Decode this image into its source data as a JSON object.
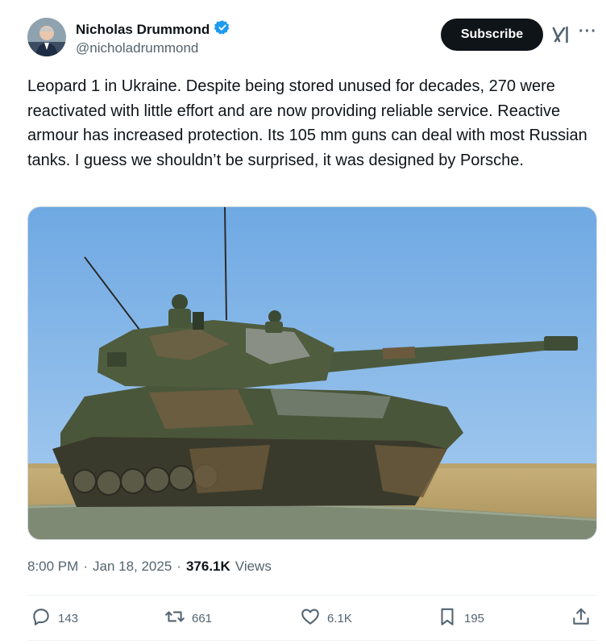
{
  "author": {
    "display_name": "Nicholas Drummond",
    "handle": "@nicholadrummond",
    "verified_icon": "verified-badge-icon"
  },
  "header": {
    "subscribe_label": "Subscribe",
    "grok_icon": "grok-icon",
    "more_icon": "more-icon"
  },
  "tweet": {
    "text": "Leopard 1 in Ukraine. Despite being stored unused for decades, 270 were reactivated with little effort and are now providing reliable service. Reactive armour has increased protection. Its 105 mm guns can deal with most Russian tanks. I guess we shouldn’t be surprised, it was designed by Porsche."
  },
  "meta": {
    "time": "8:00 PM",
    "date": "Jan 18, 2025",
    "separator": "·",
    "views_count": "376.1K",
    "views_label": "Views"
  },
  "actions": {
    "replies": "143",
    "reposts": "661",
    "likes": "6.1K",
    "bookmarks": "195"
  },
  "colors": {
    "text_primary": "#0f1419",
    "text_secondary": "#536471",
    "verified_blue": "#1d9bf0",
    "button_dark": "#0f1419"
  }
}
